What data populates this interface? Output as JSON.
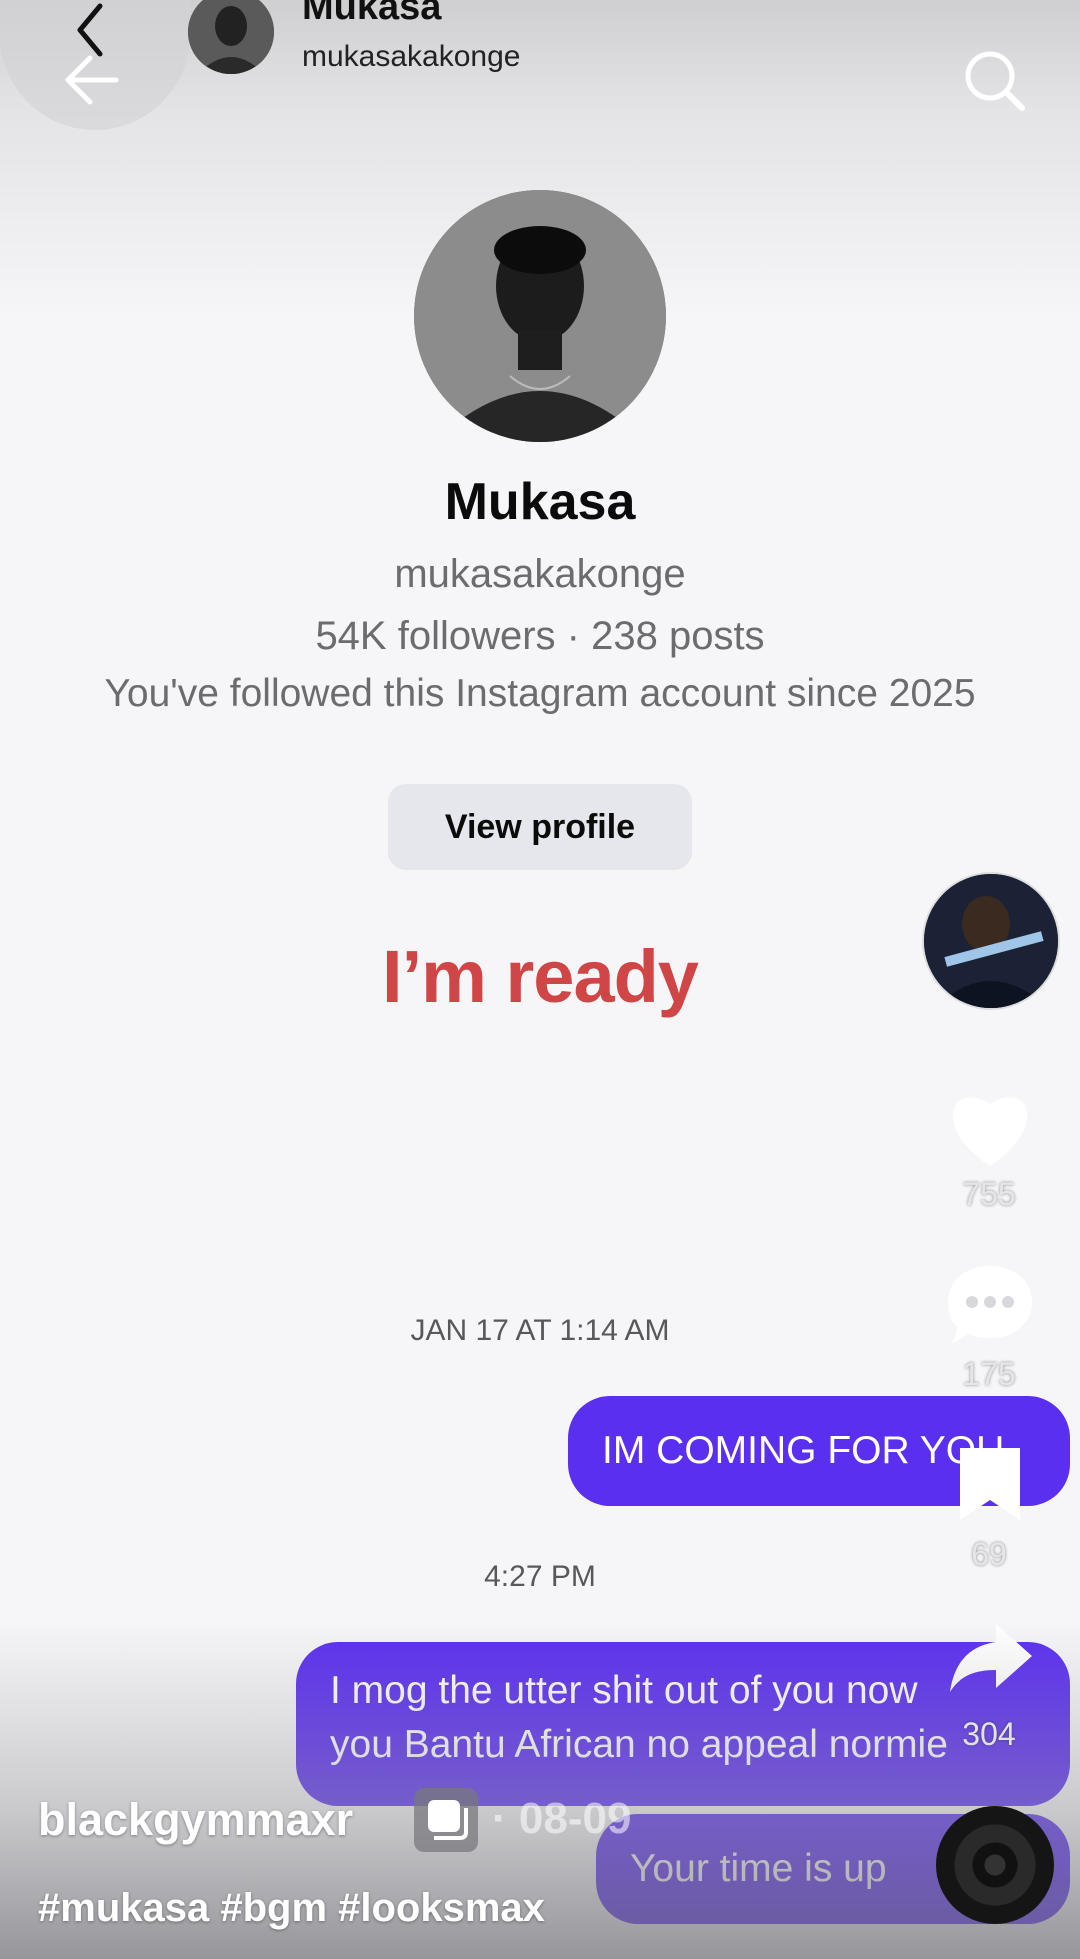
{
  "header": {
    "name": "Mukasa",
    "handle": "mukasakakonge"
  },
  "profile": {
    "name": "Mukasa",
    "handle": "mukasakakonge",
    "stats": "54K followers · 238 posts",
    "since": "You've followed this Instagram account since 2025",
    "view_profile_label": "View profile"
  },
  "overlay_caption": "I’m ready",
  "messages": {
    "timestamp_1": "JAN 17 AT 1:14 AM",
    "bubble_1": "IM COMING FOR YOU",
    "timestamp_2": "4:27 PM",
    "bubble_2_line1": "I mog the utter shit out of you now",
    "bubble_2_line2": "you Bantu African no appeal normie",
    "bubble_3": "Your time is up"
  },
  "actions": {
    "likes": "755",
    "comments": "175",
    "saves": "69",
    "shares": "304"
  },
  "post": {
    "username": "blackgymmaxr",
    "date": "· 08-09",
    "hashtags": "#mukasa #bgm #looksmax"
  },
  "colors": {
    "bubble": "#5b2ff0",
    "caption": "#d04545",
    "button_bg": "#e6e7ec"
  },
  "icons": [
    "chevron-left-icon",
    "back-arrow-icon",
    "search-icon",
    "heart-icon",
    "comment-icon",
    "bookmark-icon",
    "share-icon",
    "duplicate-icon",
    "music-disc-icon"
  ]
}
